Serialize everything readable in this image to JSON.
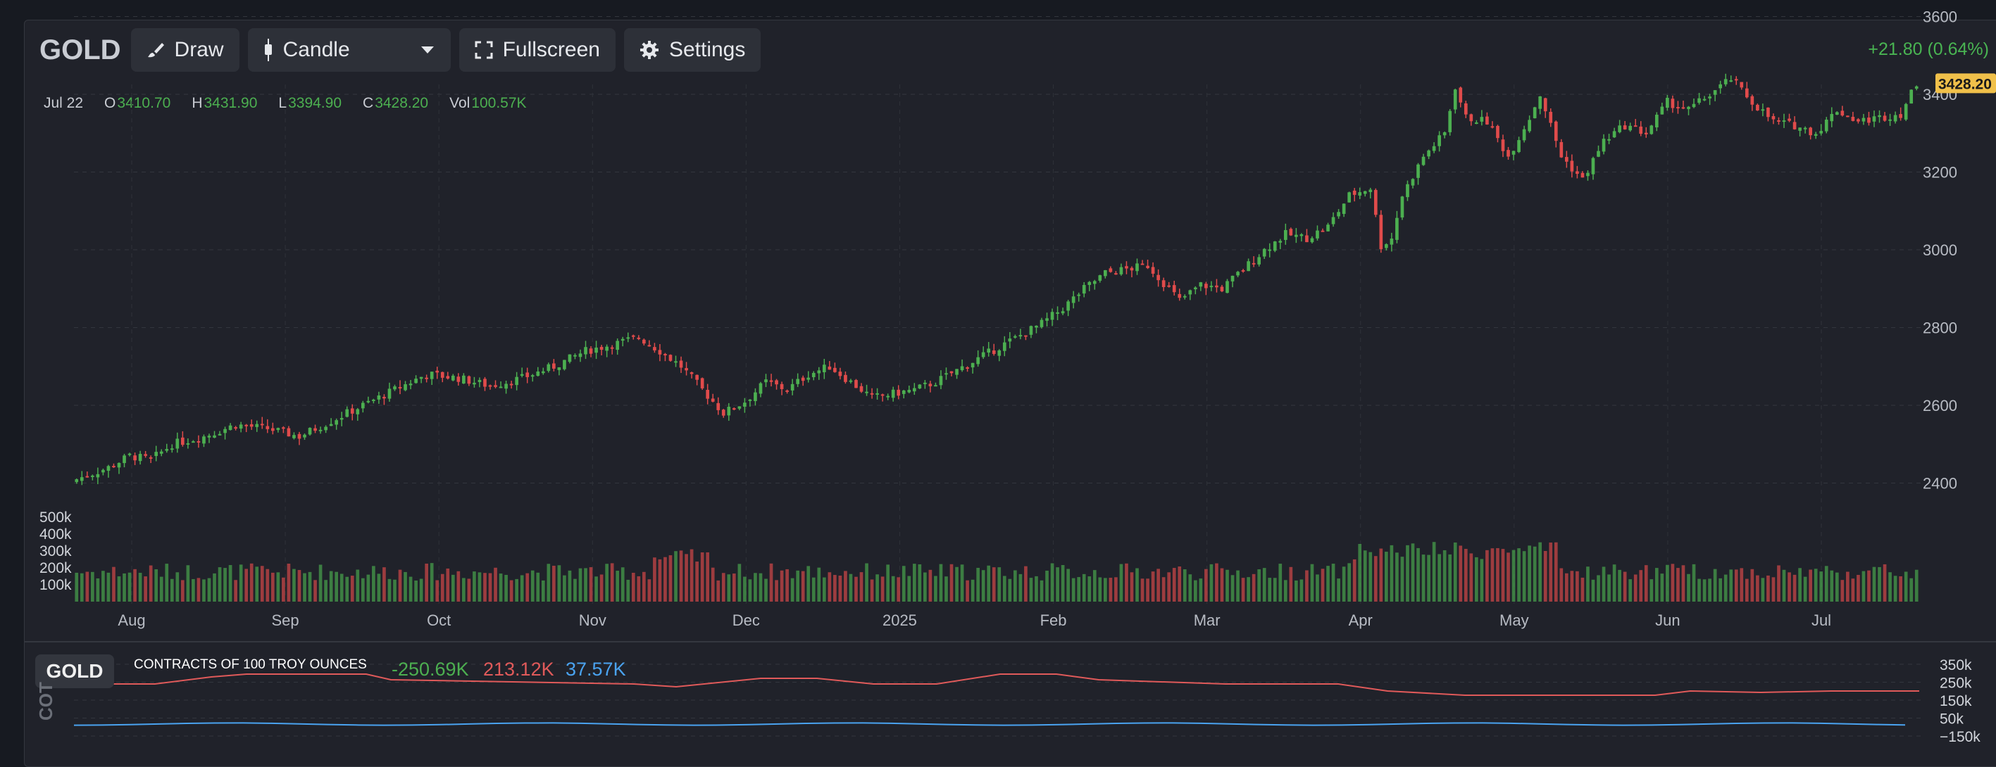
{
  "toolbar": {
    "symbol": "GOLD",
    "draw_label": "Draw",
    "chart_type_label": "Candle",
    "fullscreen_label": "Fullscreen",
    "settings_label": "Settings",
    "change_text": "+21.80 (0.64%)"
  },
  "ohlc": {
    "date": "Jul 22",
    "o_label": "O",
    "o": "3410.70",
    "h_label": "H",
    "h": "3431.90",
    "l_label": "L",
    "l": "3394.90",
    "c_label": "C",
    "c": "3428.20",
    "vol_label": "Vol",
    "vol": "100.57K"
  },
  "colors": {
    "up": "#4caf50",
    "down": "#e04b4b",
    "price_tag": "#f0c04a",
    "cot_long": "#e05a5a",
    "cot_short": "#4aa3f0"
  },
  "chart_data": {
    "type": "candlestick",
    "price_axis": {
      "ticks": [
        2400,
        2600,
        2800,
        3000,
        3200,
        3400,
        3600
      ],
      "ylim": [
        2350,
        3620
      ]
    },
    "last_price": "3428.20",
    "x_labels": [
      "Aug",
      "Sep",
      "Oct",
      "Nov",
      "Dec",
      "2025",
      "Feb",
      "Mar",
      "Apr",
      "May",
      "Jun",
      "Jul"
    ],
    "volume_axis": {
      "ticks": [
        "100k",
        "200k",
        "300k",
        "400k",
        "500k"
      ]
    },
    "close_path": [
      [
        0,
        2410
      ],
      [
        6,
        2440
      ],
      [
        10,
        2470
      ],
      [
        14,
        2460
      ],
      [
        18,
        2500
      ],
      [
        24,
        2520
      ],
      [
        30,
        2550
      ],
      [
        36,
        2540
      ],
      [
        42,
        2520
      ],
      [
        48,
        2560
      ],
      [
        54,
        2600
      ],
      [
        60,
        2640
      ],
      [
        66,
        2680
      ],
      [
        72,
        2670
      ],
      [
        78,
        2650
      ],
      [
        84,
        2670
      ],
      [
        90,
        2700
      ],
      [
        96,
        2740
      ],
      [
        102,
        2760
      ],
      [
        106,
        2775
      ],
      [
        110,
        2740
      ],
      [
        114,
        2700
      ],
      [
        118,
        2640
      ],
      [
        122,
        2580
      ],
      [
        126,
        2610
      ],
      [
        130,
        2660
      ],
      [
        134,
        2640
      ],
      [
        138,
        2680
      ],
      [
        142,
        2700
      ],
      [
        146,
        2660
      ],
      [
        150,
        2620
      ],
      [
        154,
        2630
      ],
      [
        158,
        2640
      ],
      [
        162,
        2660
      ],
      [
        166,
        2690
      ],
      [
        170,
        2720
      ],
      [
        174,
        2750
      ],
      [
        178,
        2780
      ],
      [
        182,
        2810
      ],
      [
        186,
        2850
      ],
      [
        190,
        2900
      ],
      [
        194,
        2940
      ],
      [
        198,
        2950
      ],
      [
        202,
        2960
      ],
      [
        206,
        2900
      ],
      [
        208,
        2870
      ],
      [
        212,
        2910
      ],
      [
        216,
        2900
      ],
      [
        220,
        2950
      ],
      [
        224,
        3000
      ],
      [
        228,
        3040
      ],
      [
        232,
        3030
      ],
      [
        236,
        3060
      ],
      [
        240,
        3140
      ],
      [
        244,
        3160
      ],
      [
        246,
        3010
      ],
      [
        248,
        3030
      ],
      [
        250,
        3140
      ],
      [
        254,
        3240
      ],
      [
        258,
        3300
      ],
      [
        260,
        3420
      ],
      [
        262,
        3340
      ],
      [
        266,
        3330
      ],
      [
        270,
        3240
      ],
      [
        274,
        3340
      ],
      [
        276,
        3400
      ],
      [
        280,
        3240
      ],
      [
        284,
        3180
      ],
      [
        288,
        3280
      ],
      [
        292,
        3320
      ],
      [
        296,
        3300
      ],
      [
        300,
        3380
      ],
      [
        304,
        3360
      ],
      [
        308,
        3400
      ],
      [
        312,
        3440
      ],
      [
        316,
        3380
      ],
      [
        320,
        3330
      ],
      [
        324,
        3320
      ],
      [
        328,
        3300
      ],
      [
        332,
        3360
      ],
      [
        336,
        3330
      ],
      [
        340,
        3340
      ],
      [
        344,
        3350
      ],
      [
        347,
        3428
      ]
    ],
    "cot": {
      "label": "GOLD",
      "title": "CONTRACTS OF 100 TROY OUNCES",
      "side_label": "COT",
      "net": "-250.69K",
      "long": "213.12K",
      "short": "37.57K",
      "axis_ticks": [
        "350k",
        "250k",
        "150k",
        "50k",
        "−150k"
      ]
    }
  }
}
